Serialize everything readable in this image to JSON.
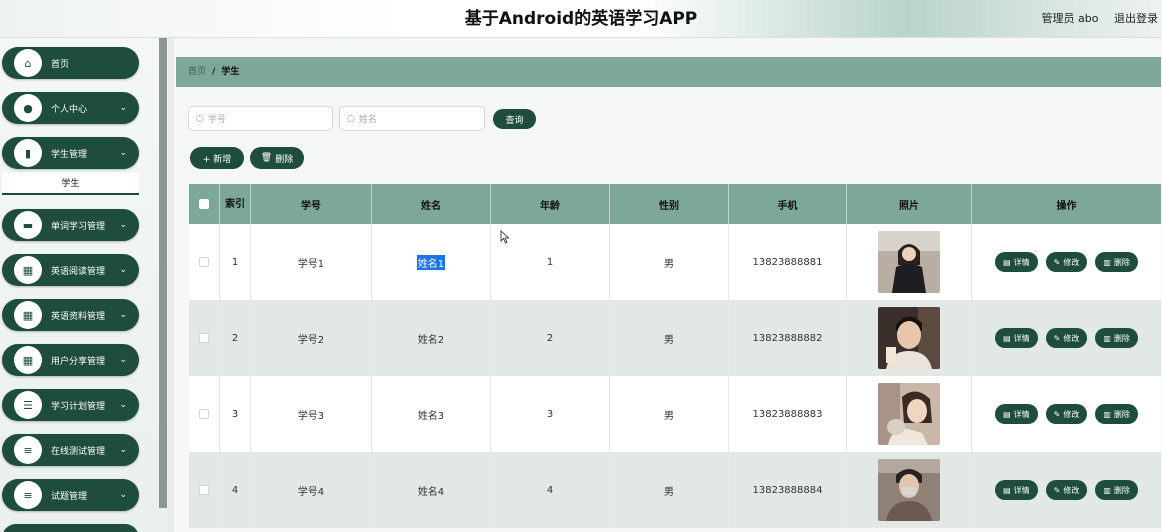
{
  "header": {
    "title": "基于Android的英语学习APP",
    "user_label": "管理员 abo",
    "logout_label": "退出登录"
  },
  "sidebar": {
    "items": [
      {
        "label": "首页",
        "icon": "home-icon",
        "glyph": "⌂"
      },
      {
        "label": "个人中心",
        "icon": "user-icon",
        "glyph": "●"
      },
      {
        "label": "学生管理",
        "icon": "book-icon",
        "glyph": "▮"
      },
      {
        "label": "单词学习管理",
        "icon": "briefcase-icon",
        "glyph": "▬"
      },
      {
        "label": "英语阅读管理",
        "icon": "grid-icon",
        "glyph": "▦"
      },
      {
        "label": "英语资料管理",
        "icon": "grid-icon",
        "glyph": "▦"
      },
      {
        "label": "用户分享管理",
        "icon": "grid-icon",
        "glyph": "▦"
      },
      {
        "label": "学习计划管理",
        "icon": "sliders-icon",
        "glyph": "☰"
      },
      {
        "label": "在线测试管理",
        "icon": "list-icon",
        "glyph": "≡"
      },
      {
        "label": "试题管理",
        "icon": "list-icon",
        "glyph": "≡"
      }
    ],
    "active_submenu": "学生"
  },
  "breadcrumb": {
    "home": "首页",
    "separator": "/",
    "current": "学生"
  },
  "search": {
    "student_id_placeholder": "学号",
    "name_placeholder": "姓名",
    "query_label": "查询"
  },
  "actions": {
    "add_label": "+ 新增",
    "delete_label": "删除"
  },
  "table": {
    "columns": [
      "索引",
      "学号",
      "姓名",
      "年龄",
      "性别",
      "手机",
      "照片",
      "操作"
    ],
    "rows": [
      {
        "index": "1",
        "student_id": "学号1",
        "name": "姓名1",
        "age": "1",
        "gender": "男",
        "phone": "13823888881"
      },
      {
        "index": "2",
        "student_id": "学号2",
        "name": "姓名2",
        "age": "2",
        "gender": "男",
        "phone": "13823888882"
      },
      {
        "index": "3",
        "student_id": "学号3",
        "name": "姓名3",
        "age": "3",
        "gender": "男",
        "phone": "13823888883"
      },
      {
        "index": "4",
        "student_id": "学号4",
        "name": "姓名4",
        "age": "4",
        "gender": "男",
        "phone": "13823888884"
      }
    ],
    "row_actions": {
      "detail": "详情",
      "edit": "修改",
      "delete": "删除"
    }
  },
  "colors": {
    "accent": "#1e4d3c",
    "header_bg": "#7da898",
    "row_alt": "#e2e8e6"
  }
}
